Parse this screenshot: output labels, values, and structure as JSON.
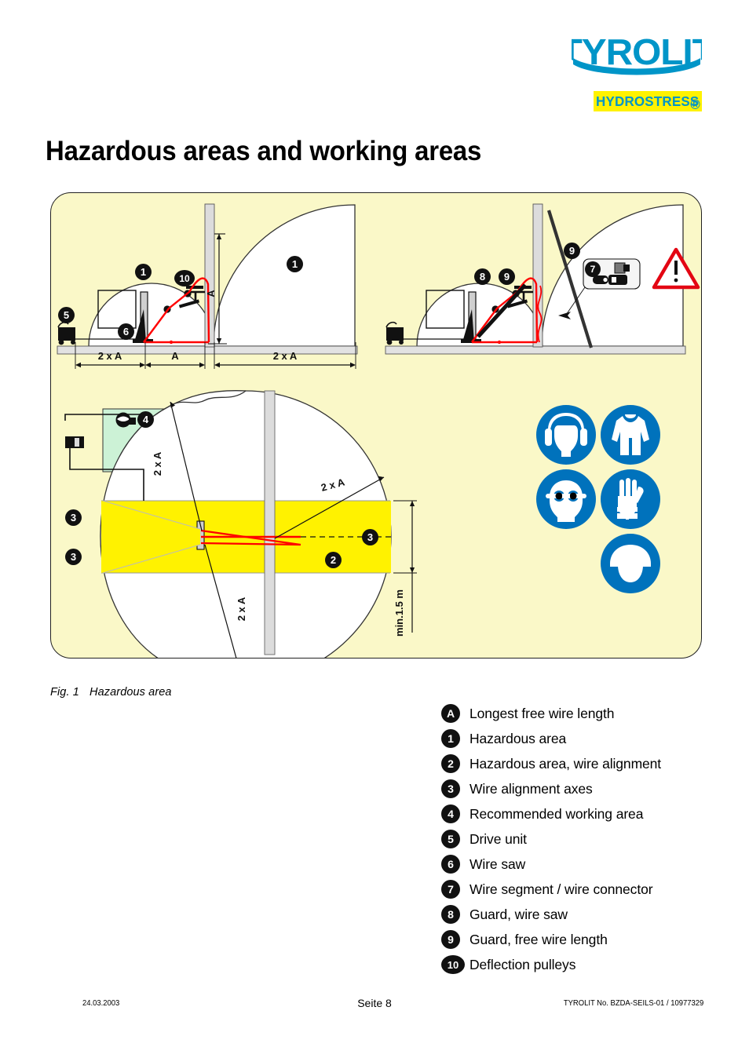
{
  "brand": {
    "logo_primary": "TYROLIT",
    "logo_secondary": "HYDROSTRESS",
    "registered_mark": "®",
    "logo_color": "#0095C8",
    "logo_band_color": "#FFF200"
  },
  "header": {
    "title": "Hazardous areas and working areas"
  },
  "figure": {
    "caption_number": "Fig. 1",
    "caption_text": "Hazardous area",
    "panel_fill": "#FAF8C8",
    "hazard_band_color": "#FFF200",
    "working_area_color": "#CCF2D6",
    "wire_color": "#FF0000",
    "wall_color": "#D9D9D9",
    "dimensions": {
      "top_left": [
        "2 x A",
        "A",
        "2 x A"
      ],
      "vertical_height": "A",
      "plan_radius_upper": "2 x A",
      "plan_radius_lower": "2 x A",
      "plan_radius_right": "2 x A",
      "min_height": "min.1.5 m"
    },
    "callouts_top_left": [
      "1",
      "1",
      "5",
      "6",
      "10"
    ],
    "callouts_top_right": [
      "7",
      "8",
      "9",
      "9"
    ],
    "callouts_bottom": [
      "2",
      "3",
      "3",
      "3",
      "4"
    ],
    "warning_symbol": "!"
  },
  "ppe_signs": [
    {
      "name": "ear-protection-sign",
      "label": "ear protection"
    },
    {
      "name": "protective-clothing-sign",
      "label": "protective clothing"
    },
    {
      "name": "eye-protection-sign",
      "label": "eye protection"
    },
    {
      "name": "protective-gloves-sign",
      "label": "protective gloves"
    },
    {
      "name": "hard-hat-sign",
      "label": "head protection"
    }
  ],
  "legend": [
    {
      "key": "A",
      "label": "Longest free wire length"
    },
    {
      "key": "1",
      "label": "Hazardous area"
    },
    {
      "key": "2",
      "label": "Hazardous area, wire alignment"
    },
    {
      "key": "3",
      "label": "Wire alignment axes"
    },
    {
      "key": "4",
      "label": "Recommended working area"
    },
    {
      "key": "5",
      "label": "Drive unit"
    },
    {
      "key": "6",
      "label": "Wire saw"
    },
    {
      "key": "7",
      "label": "Wire segment / wire connector"
    },
    {
      "key": "8",
      "label": "Guard, wire saw"
    },
    {
      "key": "9",
      "label": "Guard, free wire length"
    },
    {
      "key": "10",
      "label": "Deflection pulleys"
    }
  ],
  "footer": {
    "date": "24.03.2003",
    "page": "Seite 8",
    "doc_ref": "TYROLIT No. BZDA-SEILS-01  / 10977329"
  }
}
